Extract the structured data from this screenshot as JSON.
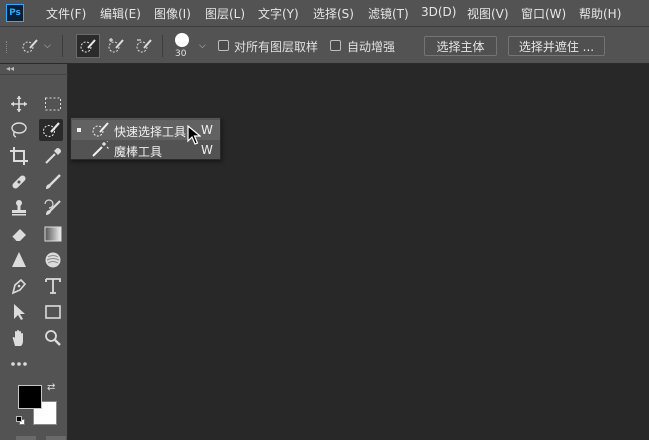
{
  "app": {
    "logo_text": "Ps",
    "accent_color": "#31a8ff"
  },
  "menubar": {
    "items": [
      {
        "label": "文件(F)"
      },
      {
        "label": "编辑(E)"
      },
      {
        "label": "图像(I)"
      },
      {
        "label": "图层(L)"
      },
      {
        "label": "文字(Y)"
      },
      {
        "label": "选择(S)"
      },
      {
        "label": "滤镜(T)"
      },
      {
        "label": "3D(D)"
      },
      {
        "label": "视图(V)"
      },
      {
        "label": "窗口(W)"
      },
      {
        "label": "帮助(H)"
      }
    ]
  },
  "options_bar": {
    "brush_size": "30",
    "sample_all_layers_label": "对所有图层取样",
    "auto_enhance_label": "自动增强",
    "select_subject_label": "选择主体",
    "select_and_mask_label": "选择并遮住 ...",
    "sample_all_layers_checked": false,
    "auto_enhance_checked": false
  },
  "toolbar": {
    "collapse_glyph": "◂◂",
    "tools": [
      {
        "name": "move-tool-icon"
      },
      {
        "name": "marquee-tool-icon"
      },
      {
        "name": "lasso-tool-icon"
      },
      {
        "name": "quick-selection-tool-icon",
        "active": true
      },
      {
        "name": "crop-tool-icon"
      },
      {
        "name": "eyedropper-tool-icon"
      },
      {
        "name": "healing-brush-tool-icon"
      },
      {
        "name": "brush-tool-icon"
      },
      {
        "name": "clone-stamp-tool-icon"
      },
      {
        "name": "history-brush-tool-icon"
      },
      {
        "name": "eraser-tool-icon"
      },
      {
        "name": "gradient-tool-icon"
      },
      {
        "name": "blur-tool-icon"
      },
      {
        "name": "dodge-tool-icon"
      },
      {
        "name": "pen-tool-icon"
      },
      {
        "name": "type-tool-icon"
      },
      {
        "name": "path-selection-tool-icon"
      },
      {
        "name": "rectangle-tool-icon"
      },
      {
        "name": "hand-tool-icon"
      },
      {
        "name": "zoom-tool-icon"
      },
      {
        "name": "more-tools-icon"
      }
    ],
    "foreground_color": "#000000",
    "background_color": "#ffffff"
  },
  "flyout": {
    "items": [
      {
        "label": "快速选择工具",
        "shortcut": "W",
        "selected": true
      },
      {
        "label": "魔棒工具",
        "shortcut": "W",
        "selected": false
      }
    ]
  }
}
